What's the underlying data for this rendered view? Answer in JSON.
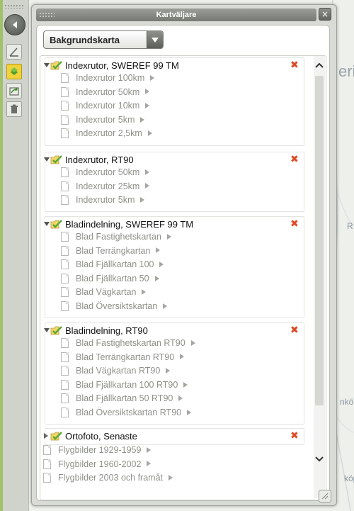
{
  "dialog": {
    "title": "Kartväljare",
    "close_label": "×"
  },
  "basemap_select": {
    "selected": "Bakgrundskarta"
  },
  "map_labels": {
    "label_1": "erig",
    "label_2": "nköp",
    "label_3": "köp",
    "label_4": "R"
  },
  "groups": [
    {
      "title": "Indexrutor, SWEREF 99 TM",
      "expanded": true,
      "items": [
        "Indexrutor 100km",
        "Indexrutor 50km",
        "Indexrutor 10km",
        "Indexrutor 5km",
        "Indexrutor 2,5km"
      ]
    },
    {
      "title": "Indexrutor, RT90",
      "expanded": true,
      "items": [
        "Indexrutor 50km",
        "Indexrutor 25km",
        "Indexrutor 5km"
      ]
    },
    {
      "title": "Bladindelning, SWEREF 99 TM",
      "expanded": true,
      "items": [
        "Blad Fastighetskartan",
        "Blad Terrängkartan",
        "Blad Fjällkartan 100",
        "Blad Fjällkartan 50",
        "Blad Vägkartan",
        "Blad Översiktskartan"
      ]
    },
    {
      "title": "Bladindelning, RT90",
      "expanded": true,
      "items": [
        "Blad Fastighetskartan RT90",
        "Blad Terrängkartan RT90",
        "Blad Vägkartan RT90",
        "Blad Fjällkartan 100 RT90",
        "Blad Fjällkartan 50 RT90",
        "Blad Översiktskartan RT90"
      ]
    },
    {
      "title": "Ortofoto, Senaste",
      "expanded": false,
      "items": []
    }
  ],
  "loose_items": [
    "Flygbilder 1929-1959",
    "Flygbilder 1960-2002",
    "Flygbilder 2003 och framåt"
  ],
  "colors": {
    "remove_icon": "#e04a25",
    "active_tool": "#f1d23a",
    "folder_green": "#5aa832"
  }
}
